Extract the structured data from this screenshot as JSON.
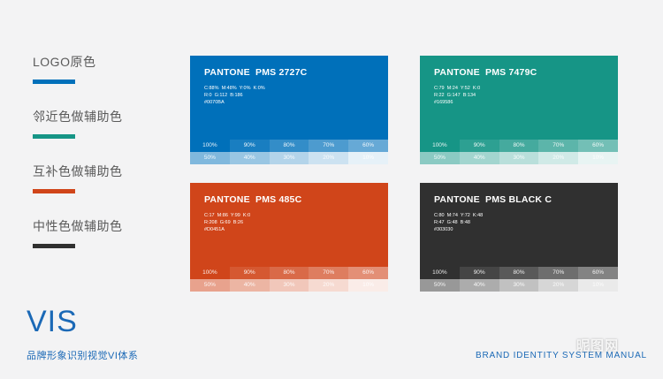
{
  "legend": [
    {
      "label": "LOGO原色",
      "color": "#0070BA"
    },
    {
      "label": "邻近色做辅助色",
      "color": "#169586"
    },
    {
      "label": "互补色做辅助色",
      "color": "#D0451A"
    },
    {
      "label": "中性色做辅助色",
      "color": "#303030"
    }
  ],
  "cards": [
    {
      "pantone": "PANTONE  PMS 2727C",
      "spec1": "C:88%  M:48%  Y:0%  K:0%",
      "spec2": "R:0  G:112  B:186",
      "spec3": "#0070BA",
      "color": "#0070BA"
    },
    {
      "pantone": "PANTONE  PMS 7479C",
      "spec1": "C:79  M:24  Y:52  K:0",
      "spec2": "R:22  G:147  B:134",
      "spec3": "#169586",
      "color": "#169586"
    },
    {
      "pantone": "PANTONE  PMS 485C",
      "spec1": "C:17  M:86  Y:99  K:0",
      "spec2": "R:208  G:69  B:26",
      "spec3": "#D0451A",
      "color": "#D0451A"
    },
    {
      "pantone": "PANTONE  PMS BLACK C",
      "spec1": "C:80  M:74  Y:72  K:48",
      "spec2": "R:47  G:48  B:48",
      "spec3": "#303030",
      "color": "#303030"
    }
  ],
  "tints": {
    "row1": [
      "100%",
      "90%",
      "80%",
      "70%",
      "60%"
    ],
    "row2": [
      "50%",
      "40%",
      "30%",
      "20%",
      "10%"
    ]
  },
  "footer": {
    "title": "VIS",
    "subtitle": "品牌形象识别视觉VI体系",
    "english": "BRAND IDENTITY SYSTEM MANUAL",
    "watermark": "昵图网"
  }
}
